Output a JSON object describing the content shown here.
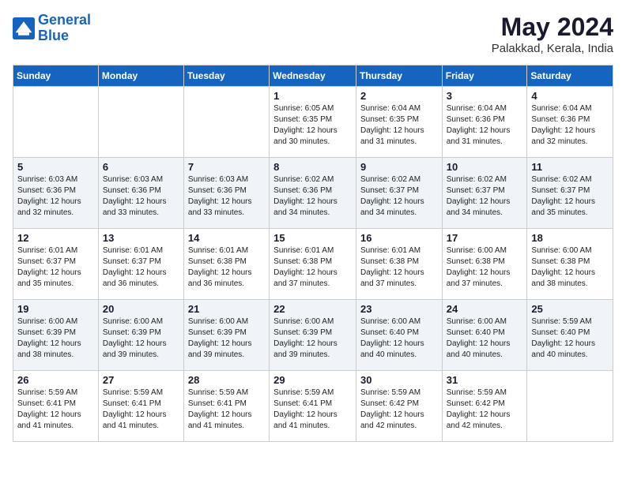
{
  "header": {
    "logo_line1": "General",
    "logo_line2": "Blue",
    "month_year": "May 2024",
    "location": "Palakkad, Kerala, India"
  },
  "weekdays": [
    "Sunday",
    "Monday",
    "Tuesday",
    "Wednesday",
    "Thursday",
    "Friday",
    "Saturday"
  ],
  "weeks": [
    [
      {
        "day": "",
        "info": ""
      },
      {
        "day": "",
        "info": ""
      },
      {
        "day": "",
        "info": ""
      },
      {
        "day": "1",
        "info": "Sunrise: 6:05 AM\nSunset: 6:35 PM\nDaylight: 12 hours\nand 30 minutes."
      },
      {
        "day": "2",
        "info": "Sunrise: 6:04 AM\nSunset: 6:35 PM\nDaylight: 12 hours\nand 31 minutes."
      },
      {
        "day": "3",
        "info": "Sunrise: 6:04 AM\nSunset: 6:36 PM\nDaylight: 12 hours\nand 31 minutes."
      },
      {
        "day": "4",
        "info": "Sunrise: 6:04 AM\nSunset: 6:36 PM\nDaylight: 12 hours\nand 32 minutes."
      }
    ],
    [
      {
        "day": "5",
        "info": "Sunrise: 6:03 AM\nSunset: 6:36 PM\nDaylight: 12 hours\nand 32 minutes."
      },
      {
        "day": "6",
        "info": "Sunrise: 6:03 AM\nSunset: 6:36 PM\nDaylight: 12 hours\nand 33 minutes."
      },
      {
        "day": "7",
        "info": "Sunrise: 6:03 AM\nSunset: 6:36 PM\nDaylight: 12 hours\nand 33 minutes."
      },
      {
        "day": "8",
        "info": "Sunrise: 6:02 AM\nSunset: 6:36 PM\nDaylight: 12 hours\nand 34 minutes."
      },
      {
        "day": "9",
        "info": "Sunrise: 6:02 AM\nSunset: 6:37 PM\nDaylight: 12 hours\nand 34 minutes."
      },
      {
        "day": "10",
        "info": "Sunrise: 6:02 AM\nSunset: 6:37 PM\nDaylight: 12 hours\nand 34 minutes."
      },
      {
        "day": "11",
        "info": "Sunrise: 6:02 AM\nSunset: 6:37 PM\nDaylight: 12 hours\nand 35 minutes."
      }
    ],
    [
      {
        "day": "12",
        "info": "Sunrise: 6:01 AM\nSunset: 6:37 PM\nDaylight: 12 hours\nand 35 minutes."
      },
      {
        "day": "13",
        "info": "Sunrise: 6:01 AM\nSunset: 6:37 PM\nDaylight: 12 hours\nand 36 minutes."
      },
      {
        "day": "14",
        "info": "Sunrise: 6:01 AM\nSunset: 6:38 PM\nDaylight: 12 hours\nand 36 minutes."
      },
      {
        "day": "15",
        "info": "Sunrise: 6:01 AM\nSunset: 6:38 PM\nDaylight: 12 hours\nand 37 minutes."
      },
      {
        "day": "16",
        "info": "Sunrise: 6:01 AM\nSunset: 6:38 PM\nDaylight: 12 hours\nand 37 minutes."
      },
      {
        "day": "17",
        "info": "Sunrise: 6:00 AM\nSunset: 6:38 PM\nDaylight: 12 hours\nand 37 minutes."
      },
      {
        "day": "18",
        "info": "Sunrise: 6:00 AM\nSunset: 6:38 PM\nDaylight: 12 hours\nand 38 minutes."
      }
    ],
    [
      {
        "day": "19",
        "info": "Sunrise: 6:00 AM\nSunset: 6:39 PM\nDaylight: 12 hours\nand 38 minutes."
      },
      {
        "day": "20",
        "info": "Sunrise: 6:00 AM\nSunset: 6:39 PM\nDaylight: 12 hours\nand 39 minutes."
      },
      {
        "day": "21",
        "info": "Sunrise: 6:00 AM\nSunset: 6:39 PM\nDaylight: 12 hours\nand 39 minutes."
      },
      {
        "day": "22",
        "info": "Sunrise: 6:00 AM\nSunset: 6:39 PM\nDaylight: 12 hours\nand 39 minutes."
      },
      {
        "day": "23",
        "info": "Sunrise: 6:00 AM\nSunset: 6:40 PM\nDaylight: 12 hours\nand 40 minutes."
      },
      {
        "day": "24",
        "info": "Sunrise: 6:00 AM\nSunset: 6:40 PM\nDaylight: 12 hours\nand 40 minutes."
      },
      {
        "day": "25",
        "info": "Sunrise: 5:59 AM\nSunset: 6:40 PM\nDaylight: 12 hours\nand 40 minutes."
      }
    ],
    [
      {
        "day": "26",
        "info": "Sunrise: 5:59 AM\nSunset: 6:41 PM\nDaylight: 12 hours\nand 41 minutes."
      },
      {
        "day": "27",
        "info": "Sunrise: 5:59 AM\nSunset: 6:41 PM\nDaylight: 12 hours\nand 41 minutes."
      },
      {
        "day": "28",
        "info": "Sunrise: 5:59 AM\nSunset: 6:41 PM\nDaylight: 12 hours\nand 41 minutes."
      },
      {
        "day": "29",
        "info": "Sunrise: 5:59 AM\nSunset: 6:41 PM\nDaylight: 12 hours\nand 41 minutes."
      },
      {
        "day": "30",
        "info": "Sunrise: 5:59 AM\nSunset: 6:42 PM\nDaylight: 12 hours\nand 42 minutes."
      },
      {
        "day": "31",
        "info": "Sunrise: 5:59 AM\nSunset: 6:42 PM\nDaylight: 12 hours\nand 42 minutes."
      },
      {
        "day": "",
        "info": ""
      }
    ]
  ]
}
